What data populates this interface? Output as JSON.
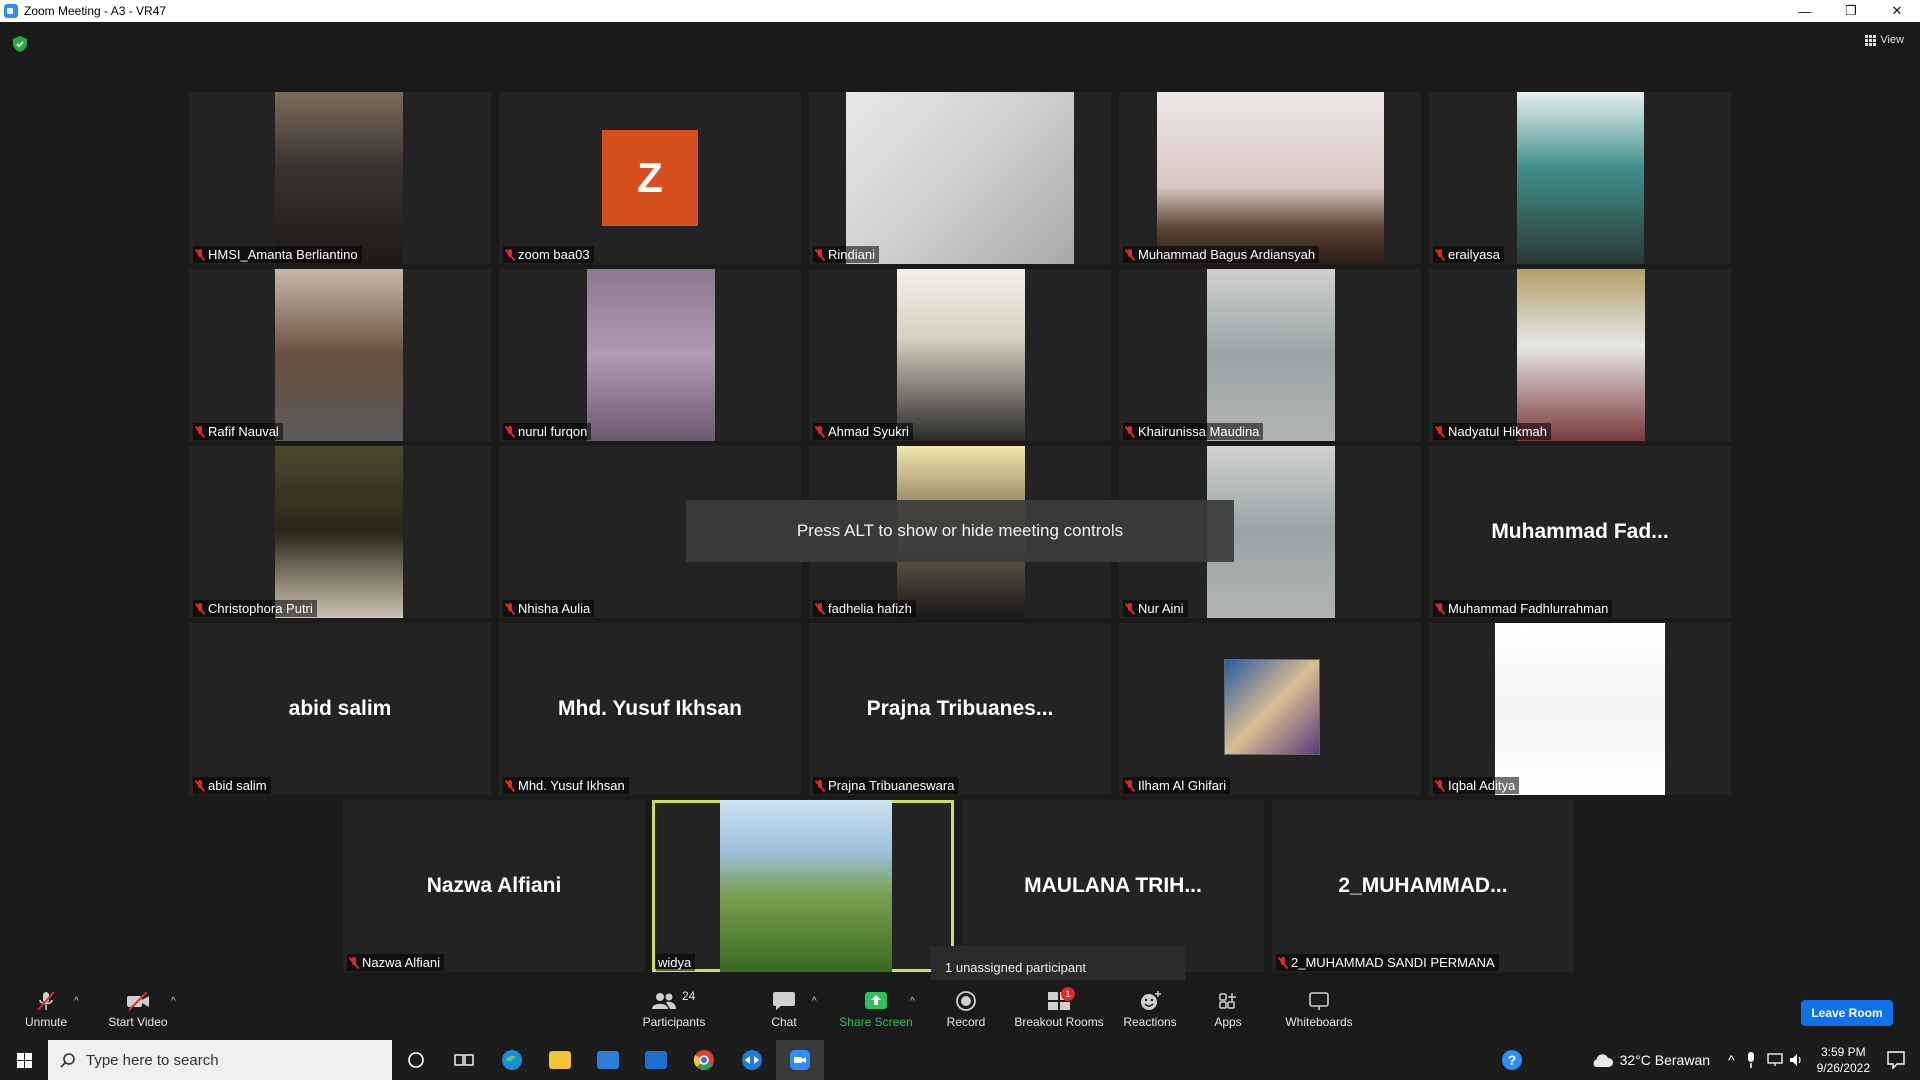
{
  "window": {
    "title": "Zoom Meeting - A3 - VR47",
    "minimize_glyph": "—",
    "restore_glyph": "❐",
    "close_glyph": "✕"
  },
  "header": {
    "view_label": "View"
  },
  "tiles": [
    {
      "name": "HMSI_Amanta Berliantino",
      "visual": "video"
    },
    {
      "name": "zoom baa03",
      "visual": "avatar",
      "initial": "Z"
    },
    {
      "name": "Rindiani",
      "visual": "video"
    },
    {
      "name": "Muhammad Bagus Ardiansyah",
      "visual": "video"
    },
    {
      "name": "erailyasa",
      "visual": "video"
    },
    {
      "name": "Rafif Nauval",
      "visual": "video"
    },
    {
      "name": "nurul furqon",
      "visual": "video"
    },
    {
      "name": "Ahmad Syukri",
      "visual": "video"
    },
    {
      "name": "Khairunissa Maudina",
      "visual": "video"
    },
    {
      "name": "Nadyatul Hikmah",
      "visual": "video"
    },
    {
      "name": "Christophora Putri",
      "visual": "video"
    },
    {
      "name": "Nhisha Aulia",
      "visual": "blank"
    },
    {
      "name": "fadhelia hafizh",
      "visual": "video"
    },
    {
      "name": "Nur Aini",
      "visual": "video"
    },
    {
      "name": "Muhammad Fadhlurrahman",
      "visual": "name",
      "display": "Muhammad  Fad..."
    },
    {
      "name": "abid salim",
      "visual": "name",
      "display": "abid salim"
    },
    {
      "name": "Mhd. Yusuf Ikhsan",
      "visual": "name",
      "display": "Mhd. Yusuf Ikhsan"
    },
    {
      "name": "Prajna Tribuaneswara",
      "visual": "name",
      "display": "Prajna  Tribuanes..."
    },
    {
      "name": "Ilham Al Ghifari",
      "visual": "thumb"
    },
    {
      "name": "Iqbal Aditya",
      "visual": "video"
    },
    {
      "name": "Nazwa Alfiani",
      "visual": "name",
      "display": "Nazwa Alfiani"
    },
    {
      "name": "widya",
      "visual": "video",
      "active_speaker": true,
      "muted": false
    },
    {
      "name": "MAULANA TRIHARTO",
      "visual": "name",
      "display": "MAULANA  TRIH...",
      "label_hidden": true
    },
    {
      "name": "2_MUHAMMAD SANDI PERMANA",
      "visual": "name",
      "display": "2_MUHAMMAD..."
    }
  ],
  "overlays": {
    "alt_toast": "Press ALT to show or hide meeting controls",
    "tooltip": "1 unassigned participant"
  },
  "toolbar": {
    "unmute": "Unmute",
    "start_video": "Start Video",
    "participants": "Participants",
    "participants_count": "24",
    "chat": "Chat",
    "share_screen": "Share Screen",
    "record": "Record",
    "breakout_rooms": "Breakout Rooms",
    "breakout_badge": "1",
    "reactions": "Reactions",
    "apps": "Apps",
    "whiteboards": "Whiteboards",
    "leave": "Leave Room"
  },
  "taskbar": {
    "search_placeholder": "Type here to search",
    "weather": "32°C  Berawan",
    "time": "3:59 PM",
    "date": "9/26/2022"
  },
  "colors": {
    "accent": "#0e72ed",
    "active_speaker_border": "#c8e056",
    "muted_mic": "#e02828",
    "share_screen": "#2fc25b",
    "avatar_bg": "#d84f1f"
  }
}
